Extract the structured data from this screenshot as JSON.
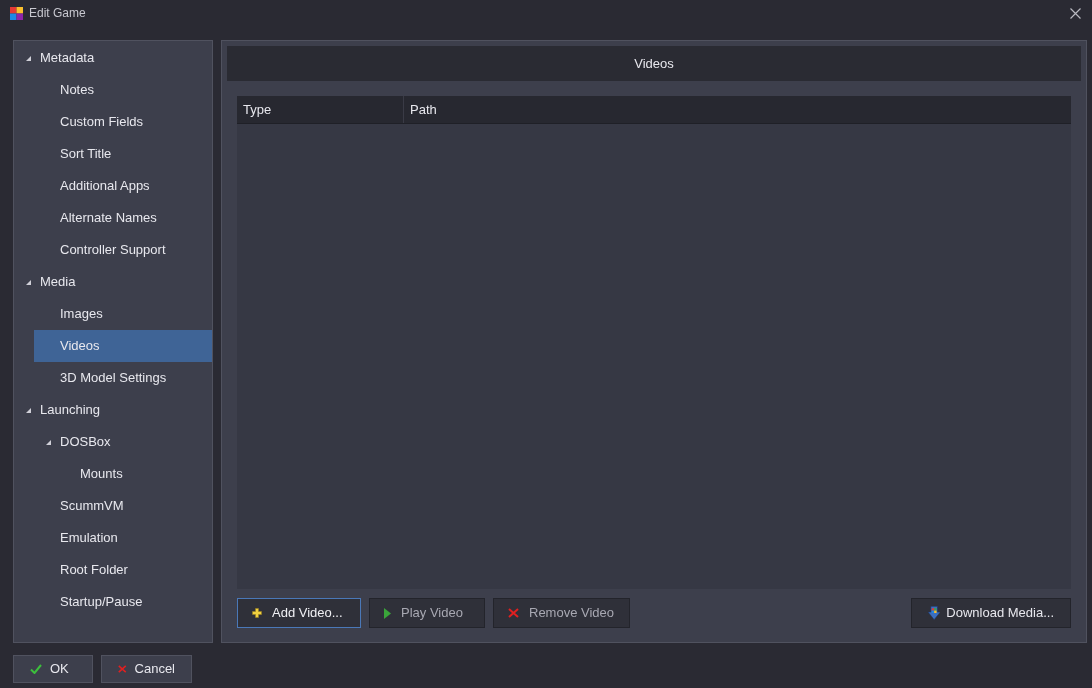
{
  "window": {
    "title": "Edit Game"
  },
  "tree": [
    {
      "label": "Metadata",
      "selected": false,
      "expanded": true,
      "children": [
        {
          "label": "Notes",
          "selected": false
        },
        {
          "label": "Custom Fields",
          "selected": false
        },
        {
          "label": "Sort Title",
          "selected": false
        },
        {
          "label": "Additional Apps",
          "selected": false
        },
        {
          "label": "Alternate Names",
          "selected": false
        },
        {
          "label": "Controller Support",
          "selected": false
        }
      ]
    },
    {
      "label": "Media",
      "selected": false,
      "expanded": true,
      "children": [
        {
          "label": "Images",
          "selected": false
        },
        {
          "label": "Videos",
          "selected": true
        },
        {
          "label": "3D Model Settings",
          "selected": false
        }
      ]
    },
    {
      "label": "Launching",
      "selected": false,
      "expanded": true,
      "children": [
        {
          "label": "DOSBox",
          "selected": false,
          "expanded": true,
          "children": [
            {
              "label": "Mounts",
              "selected": false
            }
          ]
        },
        {
          "label": "ScummVM",
          "selected": false
        },
        {
          "label": "Emulation",
          "selected": false
        },
        {
          "label": "Root Folder",
          "selected": false
        },
        {
          "label": "Startup/Pause",
          "selected": false
        }
      ]
    }
  ],
  "panel": {
    "title": "Videos"
  },
  "table": {
    "columns": [
      "Type",
      "Path"
    ]
  },
  "media_buttons": [
    {
      "label": "Add Video...",
      "kind": "add",
      "disabled": false,
      "focused": true
    },
    {
      "label": "Play Video",
      "kind": "play",
      "disabled": true,
      "focused": false
    },
    {
      "label": "Remove Video",
      "kind": "remove",
      "disabled": true,
      "focused": false
    }
  ],
  "download_button": {
    "label": "Download Media...",
    "kind": "download"
  },
  "dialog_buttons": [
    {
      "label": "OK",
      "kind": "ok"
    },
    {
      "label": "Cancel",
      "kind": "cancel"
    }
  ]
}
